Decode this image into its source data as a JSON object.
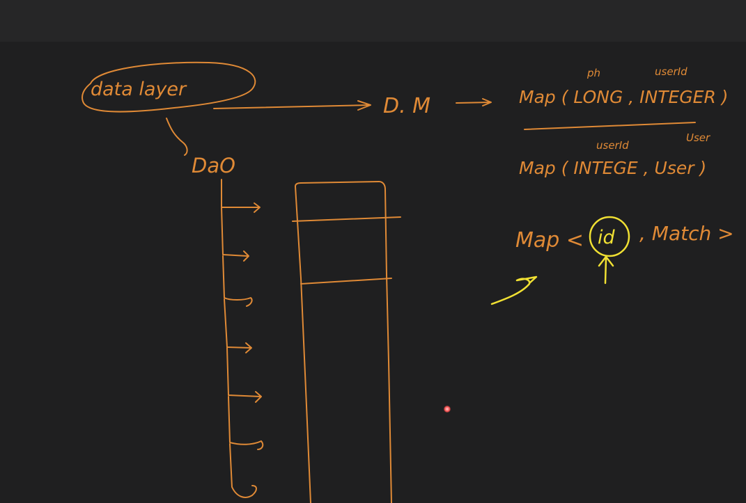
{
  "canvas": {
    "background": "#1f1f20",
    "top_bar_color": "#262627",
    "ink_orange": "#e08a36",
    "ink_yellow": "#f0e033",
    "pointer_color": "#ff5a5a"
  },
  "labels": {
    "data_layer": "data layer",
    "dao": "DaO",
    "dm": "D. M",
    "map1_text": "Map ( LONG , INTEGER )",
    "map1_annot_left": "ph",
    "map1_annot_right": "userId",
    "map2_text": "Map ( INTEGE , User )",
    "map2_annot_left": "userId",
    "map2_annot_right": "User",
    "map3_prefix": "Map <",
    "map3_id": "id",
    "map3_suffix": ", Match >"
  },
  "icons": {
    "laser_pointer": "laser-pointer-icon"
  }
}
